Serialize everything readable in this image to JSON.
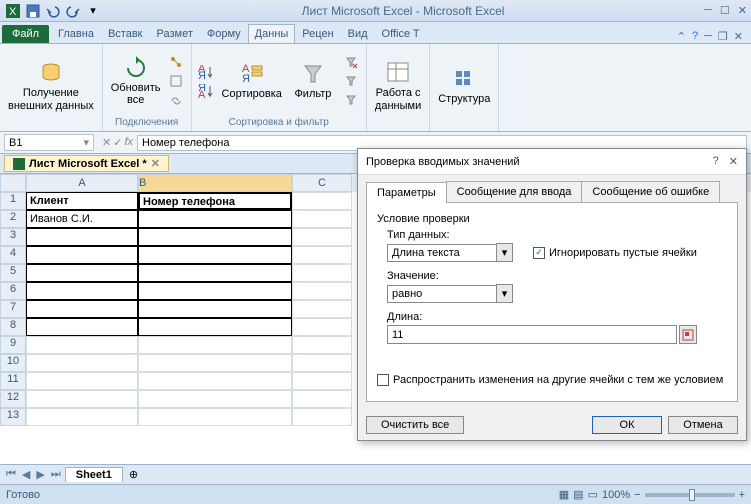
{
  "title": "Лист Microsoft Excel - Microsoft Excel",
  "tabs": {
    "file": "Файл",
    "items": [
      "Главна",
      "Вставк",
      "Размет",
      "Форму",
      "Данны",
      "Рецен",
      "Вид",
      "Office T"
    ],
    "active": 4
  },
  "ribbon": {
    "g1": {
      "btn": "Получение\nвнешних данных",
      "label": ""
    },
    "g2": {
      "btn": "Обновить\nвсе",
      "label": "Подключения"
    },
    "g3": {
      "btn": "Сортировка",
      "label": "Сортировка и фильтр",
      "filter": "Фильтр"
    },
    "g4": {
      "btn": "Работа с\nданными",
      "label": ""
    },
    "g5": {
      "btn": "Структура",
      "label": ""
    }
  },
  "namebox": "B1",
  "formula": "Номер телефона",
  "wbtab": "Лист Microsoft Excel *",
  "cols": [
    "A",
    "B",
    "C"
  ],
  "rows": [
    {
      "n": 1,
      "a": "Клиент",
      "b": "Номер телефона",
      "hdr": true
    },
    {
      "n": 2,
      "a": "Иванов С.И.",
      "b": ""
    },
    {
      "n": 3,
      "a": "",
      "b": ""
    },
    {
      "n": 4,
      "a": "",
      "b": ""
    },
    {
      "n": 5,
      "a": "",
      "b": ""
    },
    {
      "n": 6,
      "a": "",
      "b": ""
    },
    {
      "n": 7,
      "a": "",
      "b": ""
    },
    {
      "n": 8,
      "a": "",
      "b": ""
    },
    {
      "n": 9
    },
    {
      "n": 10
    },
    {
      "n": 11
    },
    {
      "n": 12
    },
    {
      "n": 13
    }
  ],
  "sheet": "Sheet1",
  "status": "Готово",
  "zoom": "100%",
  "dialog": {
    "title": "Проверка вводимых значений",
    "tabs": [
      "Параметры",
      "Сообщение для ввода",
      "Сообщение об ошибке"
    ],
    "section": "Условие проверки",
    "type_label": "Тип данных:",
    "type_value": "Длина текста",
    "ignore": "Игнорировать пустые ячейки",
    "ignore_checked": "✓",
    "val_label": "Значение:",
    "val_value": "равно",
    "len_label": "Длина:",
    "len_value": "11",
    "propagate": "Распространить изменения на другие ячейки с тем же условием",
    "clear": "Очистить все",
    "ok": "ОК",
    "cancel": "Отмена"
  }
}
